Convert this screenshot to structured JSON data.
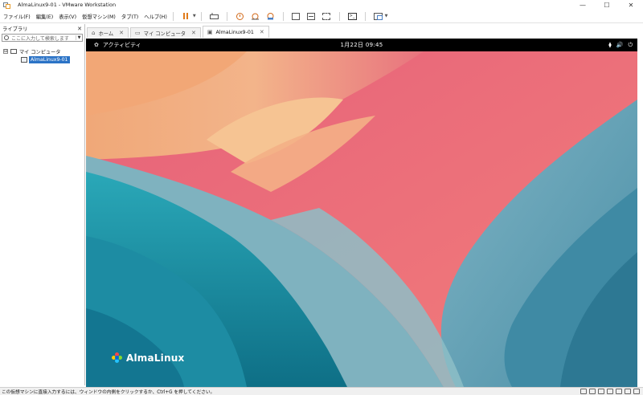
{
  "window": {
    "title": "AlmaLinux9-01 - VMware Workstation",
    "controls": [
      "—",
      "☐",
      "✕"
    ]
  },
  "menubar": {
    "items": [
      "ファイル(F)",
      "編集(E)",
      "表示(V)",
      "仮想マシン(M)",
      "タブ(T)",
      "ヘルプ(H)"
    ]
  },
  "library": {
    "title": "ライブラリ",
    "close": "✕",
    "search_placeholder": "ここに入力して検索します",
    "tree": {
      "root_label": "マイ コンピュータ",
      "root_expander": "⊟",
      "vm_label": "AlmaLinux9-01"
    }
  },
  "tabs": [
    {
      "label": "ホーム",
      "icon": "home-icon",
      "glyph": "⌂",
      "close": "✕"
    },
    {
      "label": "マイ コンピュータ",
      "icon": "monitor-icon",
      "glyph": "▭",
      "close": "✕"
    },
    {
      "label": "AlmaLinux9-01",
      "icon": "vm-icon",
      "glyph": "▣",
      "close": "✕",
      "active": true
    }
  ],
  "guest": {
    "activities": "アクティビティ",
    "clock": "1月22日  09:45",
    "sys_icons": [
      "network-icon",
      "volume-icon",
      "power-icon"
    ],
    "sys_glyphs": [
      "⧫",
      "🔊",
      "⏻"
    ],
    "brand": "AlmaLinux"
  },
  "statusbar": {
    "text": "この仮想マシンに直接入力するには、ウィンドウの内側をクリックするか、Ctrl+G を押してください。"
  }
}
